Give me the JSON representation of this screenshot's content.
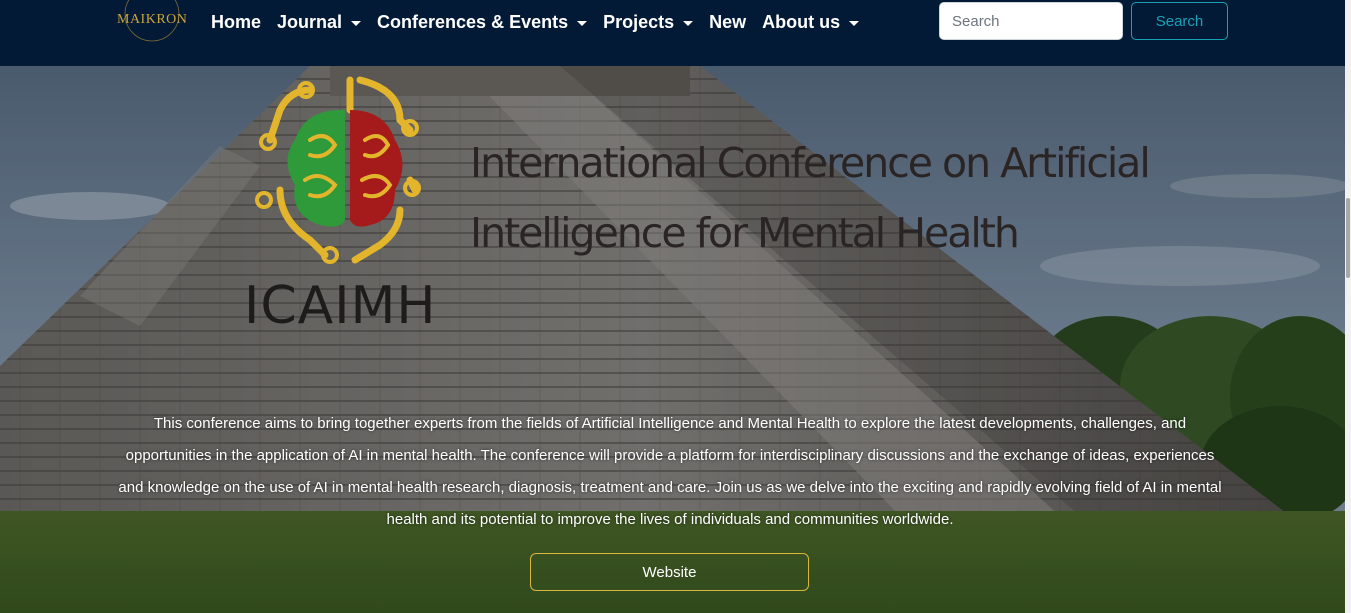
{
  "brand": {
    "logo_text": "MAIKRON",
    "logo_color": "#c9a43a"
  },
  "nav": {
    "items": [
      {
        "label": "Home",
        "dropdown": false
      },
      {
        "label": "Journal",
        "dropdown": true
      },
      {
        "label": "Conferences & Events",
        "dropdown": true
      },
      {
        "label": "Projects",
        "dropdown": true
      },
      {
        "label": "New",
        "dropdown": false
      },
      {
        "label": "About us",
        "dropdown": true
      }
    ]
  },
  "search": {
    "placeholder": "Search",
    "button_label": "Search",
    "button_color": "#17a2b8"
  },
  "hero": {
    "title": "International Conference on Artificial Intelligence for Mental Health",
    "acronym": "ICAIMH",
    "description": "This conference aims to bring together experts from the fields of Artificial Intelligence and Mental Health to explore the latest developments, challenges, and opportunities in the application of AI in mental health. The conference will provide a platform for interdisciplinary discussions and the exchange of ideas, experiences and knowledge on the use of AI in mental health research, diagnosis, treatment and care. Join us as we delve into the exciting and rapidly evolving field of AI in mental health and its potential to improve the lives of individuals and communities worldwide.",
    "website_button": "Website",
    "logo_colors": {
      "circuit": "#e3b52c",
      "left_brain": "#2e9a3a",
      "right_brain": "#a51a1a"
    }
  }
}
